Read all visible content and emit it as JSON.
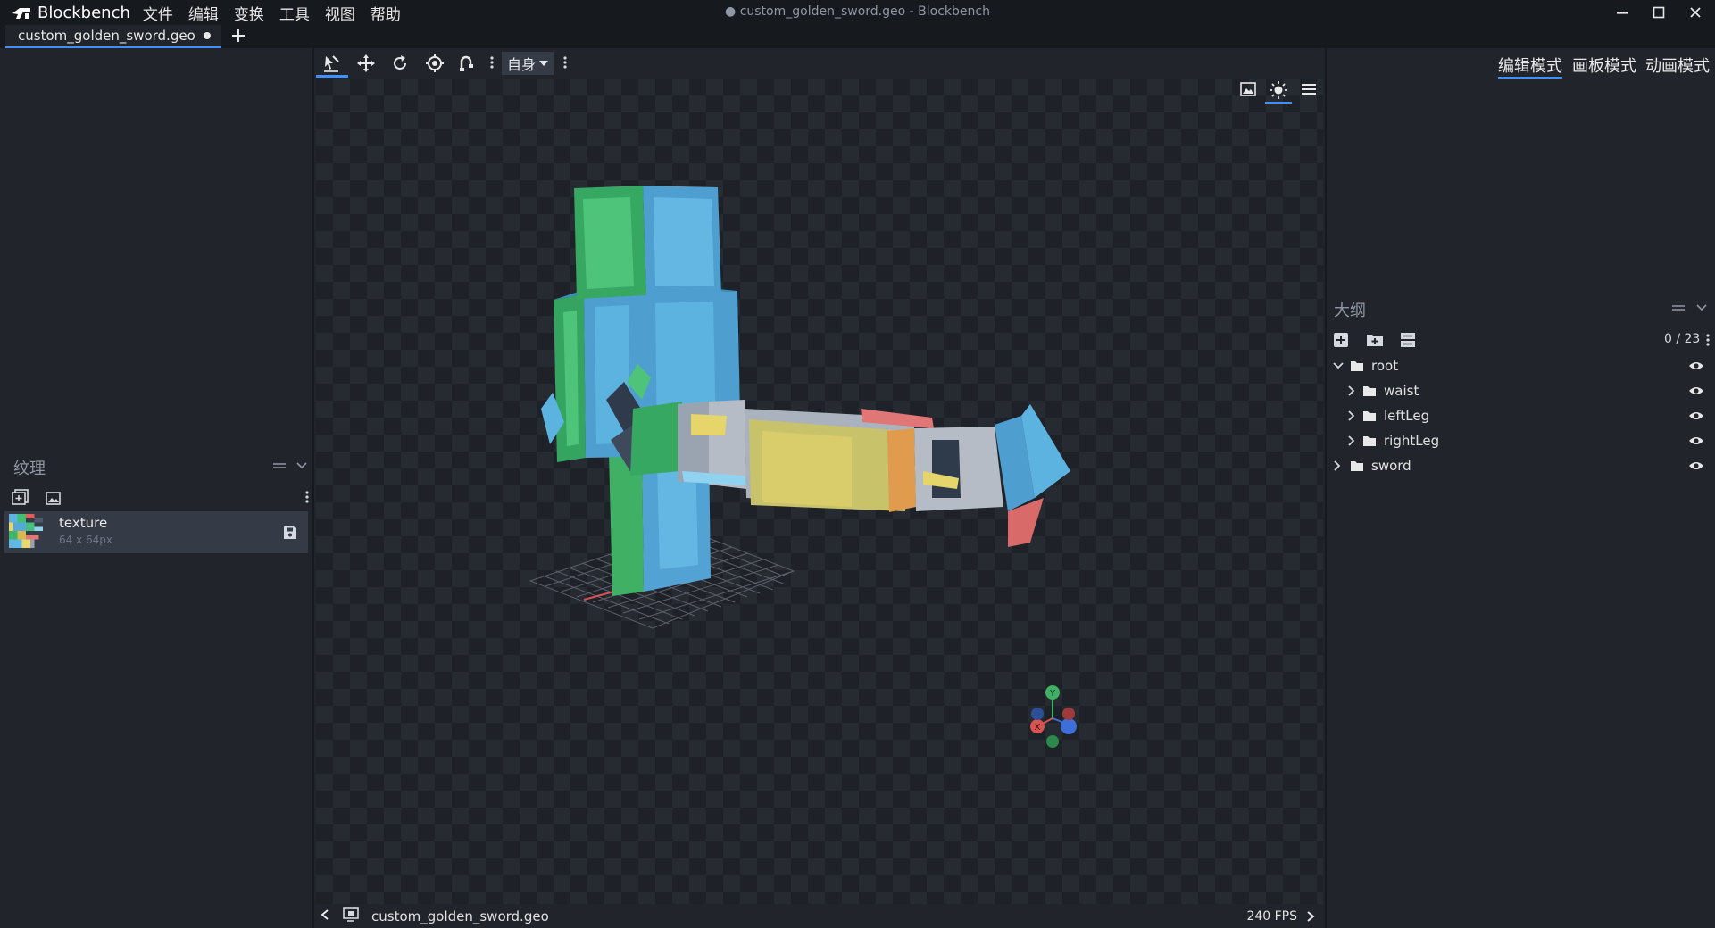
{
  "app": {
    "name": "Blockbench",
    "window_title": "● custom_golden_sword.geo - Blockbench"
  },
  "menu": [
    "文件",
    "编辑",
    "变换",
    "工具",
    "视图",
    "帮助"
  ],
  "tab": {
    "label": "custom_golden_sword.geo"
  },
  "toolbar": {
    "space_label": "自身"
  },
  "modes": [
    "编辑模式",
    "画板模式",
    "动画模式"
  ],
  "textures": {
    "title": "纹理",
    "items": [
      {
        "name": "texture",
        "size": "64 x 64px"
      }
    ]
  },
  "outliner": {
    "title": "大纲",
    "count": "0 / 23",
    "items": [
      {
        "name": "root",
        "depth": 0,
        "expanded": true
      },
      {
        "name": "waist",
        "depth": 1,
        "expanded": false
      },
      {
        "name": "leftLeg",
        "depth": 1,
        "expanded": false
      },
      {
        "name": "rightLeg",
        "depth": 1,
        "expanded": false
      },
      {
        "name": "sword",
        "depth": 0,
        "expanded": false
      }
    ]
  },
  "status": {
    "file": "custom_golden_sword.geo",
    "fps": "240 FPS"
  },
  "gizmo": {
    "y_label": "Y",
    "x_label": "X"
  },
  "colors": {
    "accent": "#3e90ff",
    "panel": "#21252b",
    "titlebar": "#161a1f",
    "viewport": "#1e2128"
  }
}
